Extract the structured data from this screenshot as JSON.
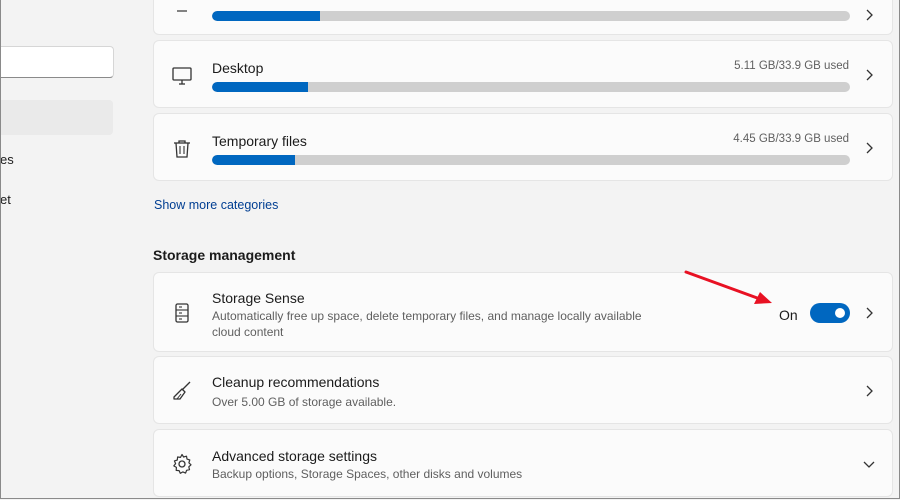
{
  "nav": {
    "item_partial_1": "es",
    "item_partial_2": "et"
  },
  "storage_categories": {
    "top_bar_progress": 0.17,
    "desktop": {
      "title": "Desktop",
      "usage": "5.11 GB/33.9 GB used",
      "progress": 0.15
    },
    "temporary_files": {
      "title": "Temporary files",
      "usage": "4.45 GB/33.9 GB used",
      "progress": 0.13
    },
    "show_more": "Show more categories"
  },
  "storage_management": {
    "heading": "Storage management",
    "storage_sense": {
      "title": "Storage Sense",
      "description_line1": "Automatically free up space, delete temporary files, and manage locally available",
      "description_line2": "cloud content",
      "toggle_label": "On",
      "toggle_on": true
    },
    "cleanup": {
      "title": "Cleanup recommendations",
      "description": "Over 5.00 GB of storage available."
    },
    "advanced": {
      "title": "Advanced storage settings",
      "description": "Backup options, Storage Spaces, other disks and volumes"
    }
  },
  "colors": {
    "accent": "#0067c0",
    "annotation_arrow": "#e81123",
    "link": "#003e92"
  }
}
